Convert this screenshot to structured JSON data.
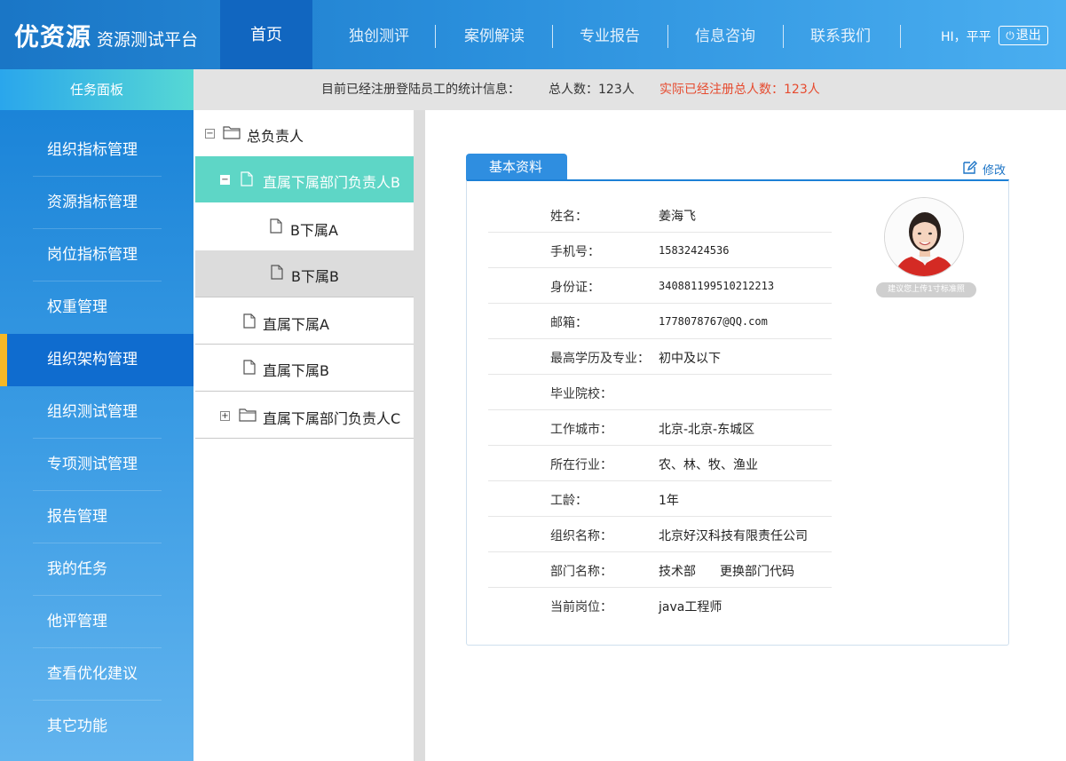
{
  "header": {
    "brand": "优资源",
    "subtitle": "资源测试平台",
    "nav_home": "首页",
    "nav": [
      "独创测评",
      "案例解读",
      "专业报告",
      "信息咨询",
      "联系我们"
    ],
    "greeting": "HI，平平",
    "logout": "退出"
  },
  "taskbar": {
    "label": "任务面板"
  },
  "stats": {
    "label": "目前已经注册登陆员工的统计信息：",
    "total": "总人数：123人",
    "registered": "实际已经注册总人数：123人",
    "registered_color": "#e64b2f"
  },
  "sidebar": {
    "items": [
      {
        "label": "组织指标管理"
      },
      {
        "label": "资源指标管理"
      },
      {
        "label": "岗位指标管理"
      },
      {
        "label": "权重管理"
      },
      {
        "label": "组织架构管理",
        "active": true
      },
      {
        "label": "组织测试管理"
      },
      {
        "label": "专项测试管理"
      },
      {
        "label": "报告管理"
      },
      {
        "label": "我的任务"
      },
      {
        "label": "他评管理"
      },
      {
        "label": "查看优化建议"
      },
      {
        "label": "其它功能"
      }
    ],
    "active_color": "#f6b826"
  },
  "tree": {
    "root": "总负责人",
    "dept_b": "直属下属部门负责人B",
    "b_sub_a": "B下属A",
    "b_sub_b": "B下属B",
    "direct_a": "直属下属A",
    "direct_b": "直属下属B",
    "dept_c": "直属下属部门负责人C",
    "selected_color": "#5ed6c6"
  },
  "profile": {
    "tab": "基本资料",
    "edit": "修改",
    "avatar_hint": "建议您上传1寸标准照",
    "fields": {
      "name": {
        "label": "姓名：",
        "value": "姜海飞"
      },
      "phone": {
        "label": "手机号：",
        "value": "15832424536"
      },
      "id_card": {
        "label": "身份证：",
        "value": "340881199510212213"
      },
      "email": {
        "label": "邮箱：",
        "value": "1778078767@QQ.com"
      },
      "education": {
        "label": "最高学历及专业：",
        "value": "初中及以下"
      },
      "school": {
        "label": "毕业院校：",
        "value": ""
      },
      "city": {
        "label": "工作城市：",
        "value": "北京-北京-东城区"
      },
      "industry": {
        "label": "所在行业：",
        "value": "农、林、牧、渔业"
      },
      "seniority": {
        "label": "工龄：",
        "value": "1年"
      },
      "org": {
        "label": "组织名称：",
        "value": "北京好汉科技有限责任公司"
      },
      "dept": {
        "label": "部门名称：",
        "value": "技术部",
        "extra": "更换部门代码"
      },
      "position": {
        "label": "当前岗位：",
        "value": "java工程师"
      }
    }
  }
}
